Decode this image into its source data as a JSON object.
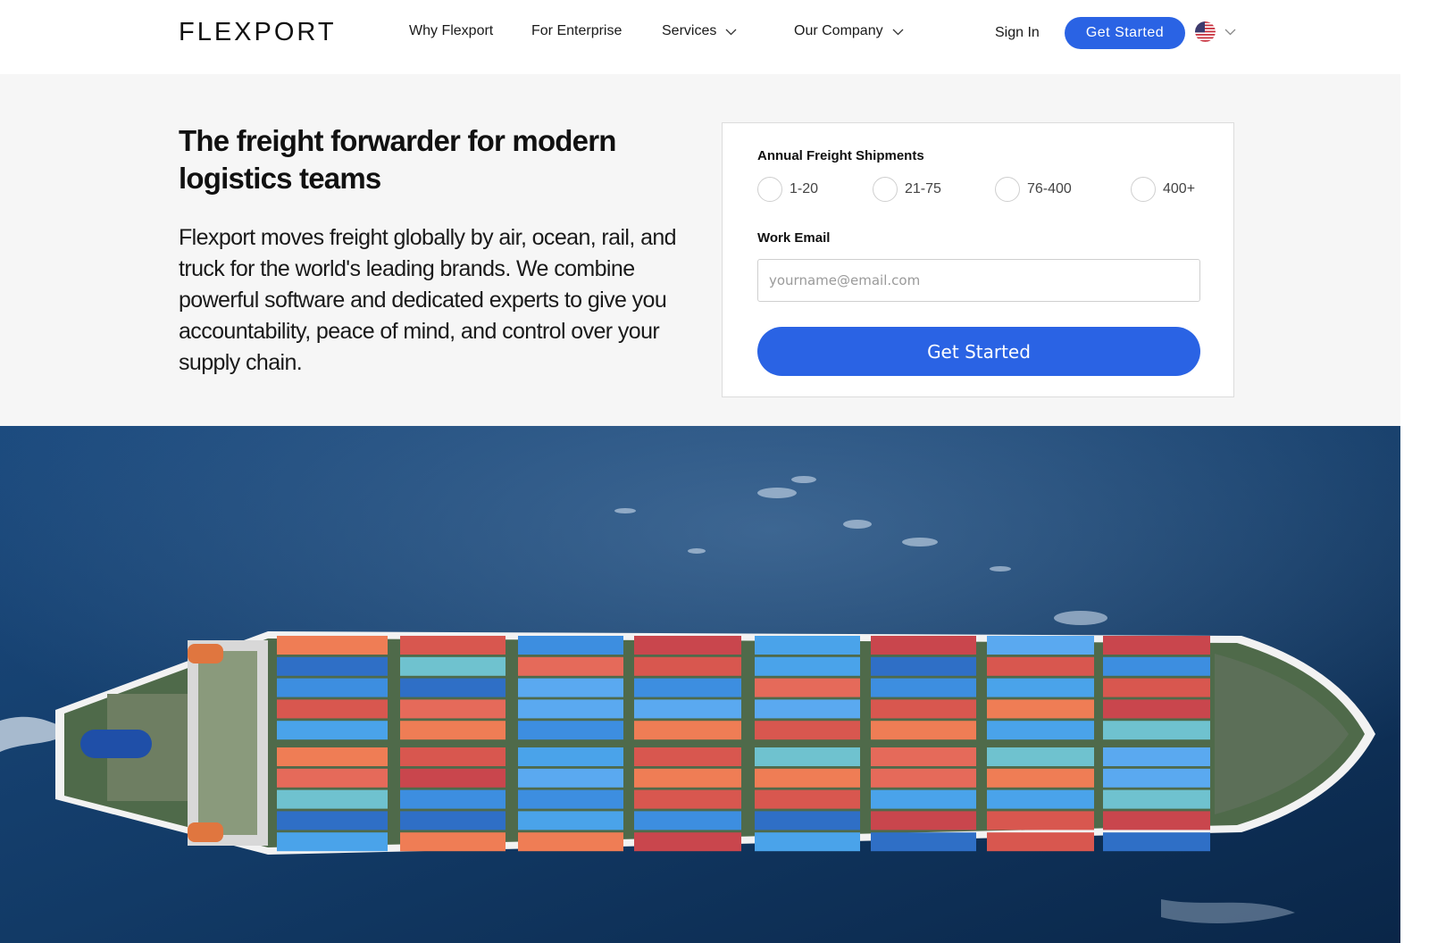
{
  "nav": {
    "logo": "FLEXPORT",
    "links": [
      {
        "label": "Why Flexport",
        "has_dropdown": false
      },
      {
        "label": "For Enterprise",
        "has_dropdown": false
      },
      {
        "label": "Services",
        "has_dropdown": true
      },
      {
        "label": "Our Company",
        "has_dropdown": true
      }
    ],
    "sign_in": "Sign In",
    "cta": "Get Started",
    "language_icon": "us-flag-icon"
  },
  "hero": {
    "headline": "The freight forwarder for modern logistics teams",
    "lead": "Flexport moves freight globally by air, ocean, rail, and truck for the world's leading brands. We combine powerful software and dedicated experts to give you accountability, peace of mind, and control over your supply chain."
  },
  "form": {
    "shipments_label": "Annual Freight Shipments",
    "shipment_options": [
      "1-20",
      "21-75",
      "76-400",
      "400+"
    ],
    "email_label": "Work Email",
    "email_placeholder": "yourname@email.com",
    "email_value": "",
    "submit": "Get Started"
  },
  "colors": {
    "accent": "#2a63e4",
    "hero_bg": "#f6f6f6",
    "ocean": "#123a66"
  }
}
